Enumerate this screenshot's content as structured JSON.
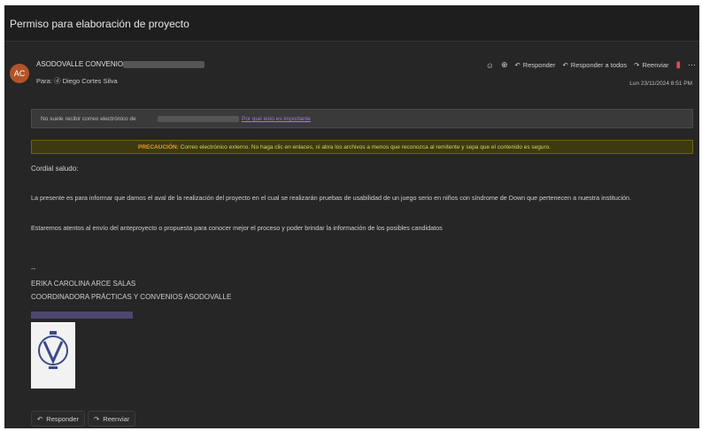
{
  "window": {
    "subject": "Permiso para elaboración de proyecto"
  },
  "header": {
    "avatar_initials": "AC",
    "sender": "ASODOVALLE CONVENIOS",
    "to": "Para: ⓓ Diego Cortes Silva",
    "date": "Lun 23/11/2024 8:51 PM",
    "actions": {
      "reply": "Responder",
      "reply_all": "Responder a todos",
      "forward": "Reenviar"
    }
  },
  "infobar": {
    "text": "No suele recibir correo electrónico de",
    "link": "Por qué esto es importante"
  },
  "warning": {
    "prefix": "PRECAUCIÓN:",
    "text": " Correo electrónico externo. No haga clic en enlaces, ni abra los archivos a menos que reconozca al remitente y sepa que el contenido es seguro."
  },
  "body": {
    "greeting": "Cordial saludo:",
    "p1": "La presente es para informar que damos el aval de la realización del proyecto en el cual se realizarán pruebas de usabilidad de un juego serio en niños con síndrome de Down que pertenecen a nuestra institución.",
    "p2": "Estaremos atentos al envío del anteproyecto o propuesta para conocer mejor el proceso y poder brindar la información de los posibles candidatos"
  },
  "signature": {
    "dash": "--",
    "name": "ERIKA CAROLINA ARCE SALAS",
    "title": "COORDINADORA PRÁCTICAS Y CONVENIOS ASODOVALLE"
  },
  "footer": {
    "reply": "Responder",
    "forward": "Reenviar"
  }
}
